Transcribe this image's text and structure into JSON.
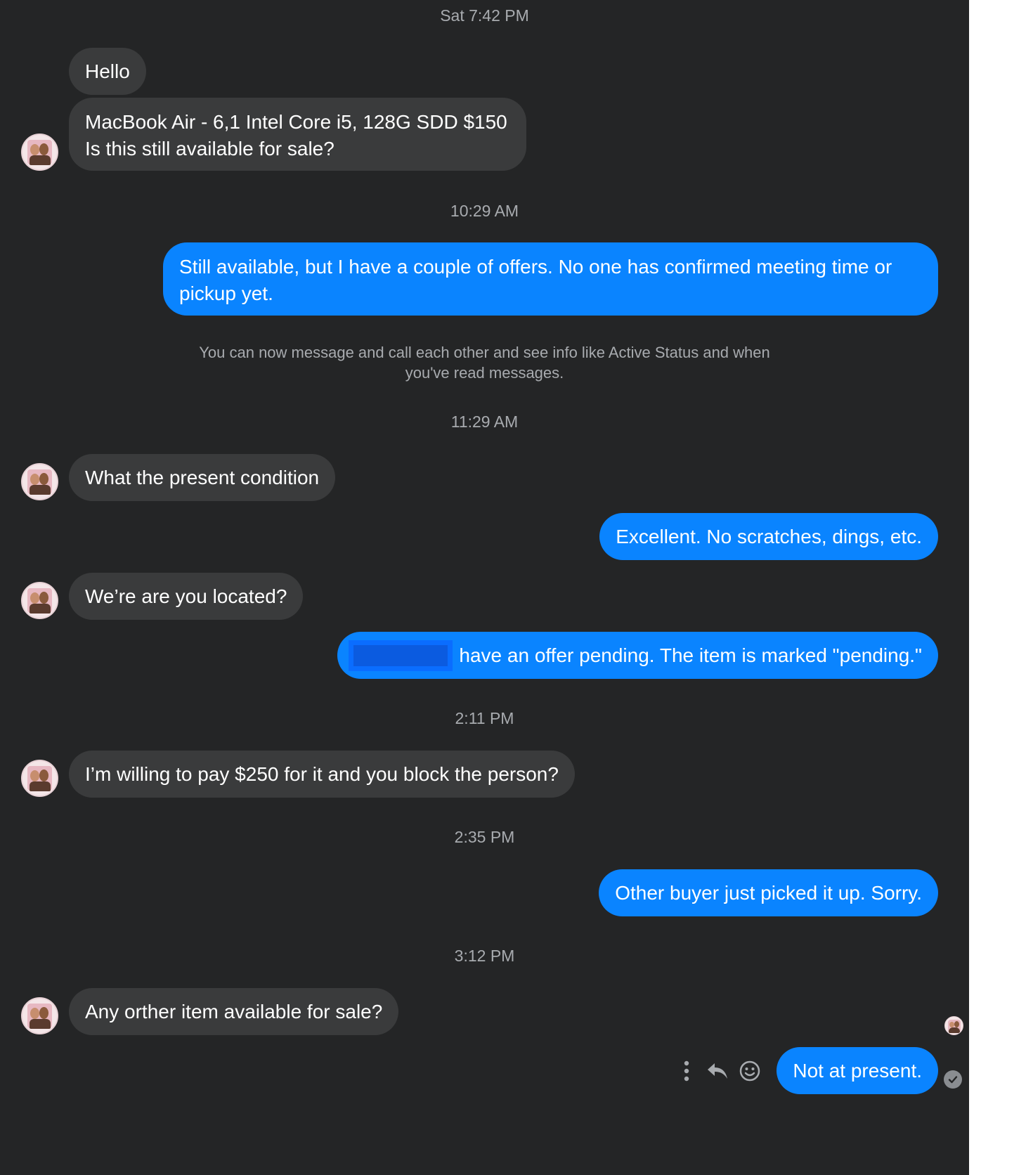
{
  "timestamps": [
    "Sat 7:42 PM",
    "10:29 AM",
    "11:29 AM",
    "2:11 PM",
    "2:35 PM",
    "3:12 PM"
  ],
  "notice": "You can now message and call each other and see info like Active Status and when you've read messages.",
  "messages": {
    "m1": "Hello",
    "m2": "MacBook Air - 6,1 Intel Core i5, 128G SDD $150 Is this still available for sale?",
    "m3": "Still available, but I have a couple of offers. No one has confirmed meeting time or pickup yet.",
    "m4": "What the present condition",
    "m5": "Excellent. No scratches, dings, etc.",
    "m6": "We’re are you located?",
    "m7": "have an offer pending. The item is marked \"pending.\"",
    "m8": "I’m willing to pay $250 for it and you block the person?",
    "m9": "Other buyer just picked it up. Sorry.",
    "m10": "Any orther item available for sale?",
    "m11": "Not at present."
  },
  "icons": {
    "more": "more-vertical-icon",
    "reply": "reply-icon",
    "react": "smiley-icon",
    "seen": "seen-check-icon"
  },
  "colors": {
    "background": "#242526",
    "incoming_bubble": "#3a3b3c",
    "outgoing_bubble": "#0a84ff",
    "meta_text": "#a8abaf"
  }
}
